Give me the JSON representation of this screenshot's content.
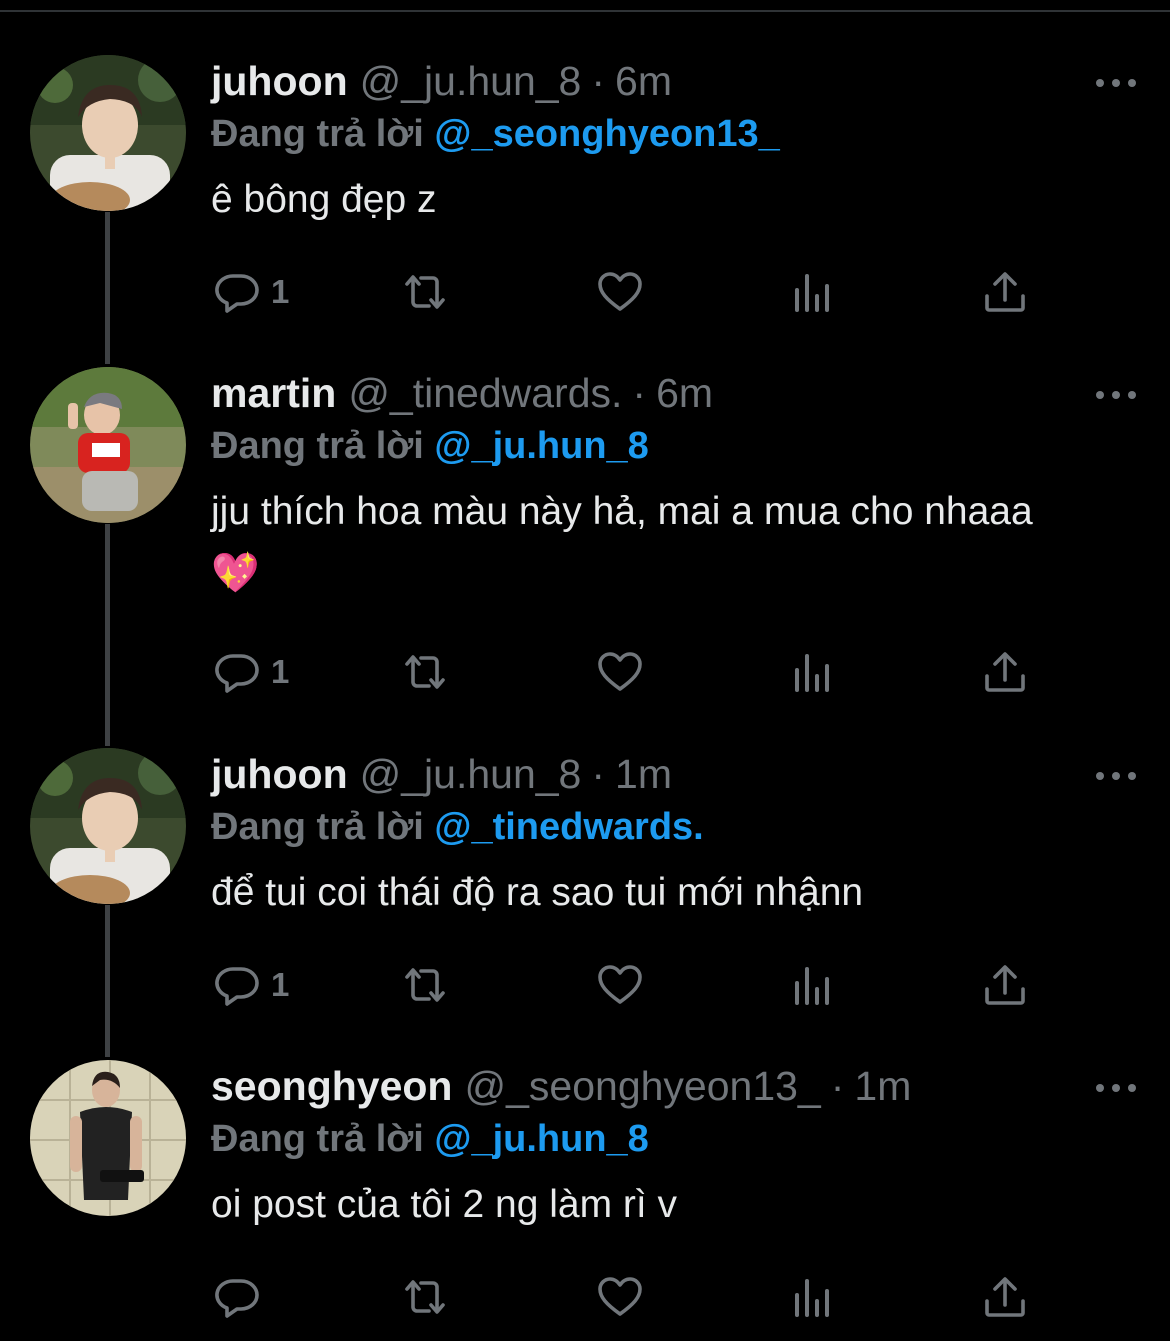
{
  "colors": {
    "background": "#000000",
    "text_primary": "#e7e9ea",
    "text_secondary": "#71767b",
    "mention": "#1d9bf0",
    "thread_line": "#3e4144"
  },
  "tweets": [
    {
      "name": "juhoon",
      "handle": "@_ju.hun_8",
      "time": "6m",
      "replying_prefix": "Đang trả lời",
      "replying_to": "@_seonghyeon13_",
      "text": "ê bông đẹp z",
      "reply_count": "1",
      "avatar": "juhoon-avatar"
    },
    {
      "name": "martin",
      "handle": "@_tinedwards.",
      "time": "6m",
      "replying_prefix": "Đang trả lời",
      "replying_to": "@_ju.hun_8",
      "text": "jju thích hoa màu này hả, mai a mua cho nhaaa💖",
      "reply_count": "1",
      "avatar": "martin-avatar"
    },
    {
      "name": "juhoon",
      "handle": "@_ju.hun_8",
      "time": "1m",
      "replying_prefix": "Đang trả lời",
      "replying_to": "@_tinedwards.",
      "text": "để tui coi thái độ ra sao tui mới nhậnn",
      "reply_count": "1",
      "avatar": "juhoon-avatar"
    },
    {
      "name": "seonghyeon",
      "handle": "@_seonghyeon13_",
      "time": "1m",
      "replying_prefix": "Đang trả lời",
      "replying_to": "@_ju.hun_8",
      "text": "oi post của tôi 2 ng làm rì v",
      "reply_count": "",
      "avatar": "seonghyeon-avatar"
    }
  ],
  "dot_separator": "·",
  "icons": {
    "reply": "reply-icon",
    "retweet": "retweet-icon",
    "like": "heart-icon",
    "views": "views-icon",
    "share": "share-icon",
    "more": "more-icon"
  }
}
